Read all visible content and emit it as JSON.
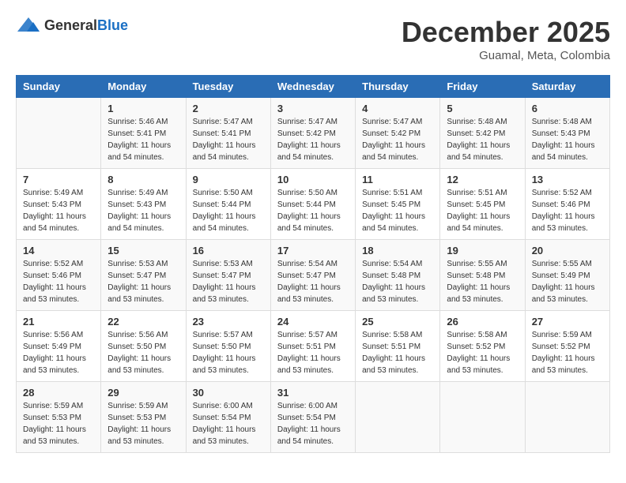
{
  "header": {
    "logo_general": "General",
    "logo_blue": "Blue",
    "month": "December 2025",
    "location": "Guamal, Meta, Colombia"
  },
  "days_of_week": [
    "Sunday",
    "Monday",
    "Tuesday",
    "Wednesday",
    "Thursday",
    "Friday",
    "Saturday"
  ],
  "weeks": [
    [
      {
        "day": "",
        "info": ""
      },
      {
        "day": "1",
        "info": "Sunrise: 5:46 AM\nSunset: 5:41 PM\nDaylight: 11 hours\nand 54 minutes."
      },
      {
        "day": "2",
        "info": "Sunrise: 5:47 AM\nSunset: 5:41 PM\nDaylight: 11 hours\nand 54 minutes."
      },
      {
        "day": "3",
        "info": "Sunrise: 5:47 AM\nSunset: 5:42 PM\nDaylight: 11 hours\nand 54 minutes."
      },
      {
        "day": "4",
        "info": "Sunrise: 5:47 AM\nSunset: 5:42 PM\nDaylight: 11 hours\nand 54 minutes."
      },
      {
        "day": "5",
        "info": "Sunrise: 5:48 AM\nSunset: 5:42 PM\nDaylight: 11 hours\nand 54 minutes."
      },
      {
        "day": "6",
        "info": "Sunrise: 5:48 AM\nSunset: 5:43 PM\nDaylight: 11 hours\nand 54 minutes."
      }
    ],
    [
      {
        "day": "7",
        "info": "Sunrise: 5:49 AM\nSunset: 5:43 PM\nDaylight: 11 hours\nand 54 minutes."
      },
      {
        "day": "8",
        "info": "Sunrise: 5:49 AM\nSunset: 5:43 PM\nDaylight: 11 hours\nand 54 minutes."
      },
      {
        "day": "9",
        "info": "Sunrise: 5:50 AM\nSunset: 5:44 PM\nDaylight: 11 hours\nand 54 minutes."
      },
      {
        "day": "10",
        "info": "Sunrise: 5:50 AM\nSunset: 5:44 PM\nDaylight: 11 hours\nand 54 minutes."
      },
      {
        "day": "11",
        "info": "Sunrise: 5:51 AM\nSunset: 5:45 PM\nDaylight: 11 hours\nand 54 minutes."
      },
      {
        "day": "12",
        "info": "Sunrise: 5:51 AM\nSunset: 5:45 PM\nDaylight: 11 hours\nand 54 minutes."
      },
      {
        "day": "13",
        "info": "Sunrise: 5:52 AM\nSunset: 5:46 PM\nDaylight: 11 hours\nand 53 minutes."
      }
    ],
    [
      {
        "day": "14",
        "info": "Sunrise: 5:52 AM\nSunset: 5:46 PM\nDaylight: 11 hours\nand 53 minutes."
      },
      {
        "day": "15",
        "info": "Sunrise: 5:53 AM\nSunset: 5:47 PM\nDaylight: 11 hours\nand 53 minutes."
      },
      {
        "day": "16",
        "info": "Sunrise: 5:53 AM\nSunset: 5:47 PM\nDaylight: 11 hours\nand 53 minutes."
      },
      {
        "day": "17",
        "info": "Sunrise: 5:54 AM\nSunset: 5:47 PM\nDaylight: 11 hours\nand 53 minutes."
      },
      {
        "day": "18",
        "info": "Sunrise: 5:54 AM\nSunset: 5:48 PM\nDaylight: 11 hours\nand 53 minutes."
      },
      {
        "day": "19",
        "info": "Sunrise: 5:55 AM\nSunset: 5:48 PM\nDaylight: 11 hours\nand 53 minutes."
      },
      {
        "day": "20",
        "info": "Sunrise: 5:55 AM\nSunset: 5:49 PM\nDaylight: 11 hours\nand 53 minutes."
      }
    ],
    [
      {
        "day": "21",
        "info": "Sunrise: 5:56 AM\nSunset: 5:49 PM\nDaylight: 11 hours\nand 53 minutes."
      },
      {
        "day": "22",
        "info": "Sunrise: 5:56 AM\nSunset: 5:50 PM\nDaylight: 11 hours\nand 53 minutes."
      },
      {
        "day": "23",
        "info": "Sunrise: 5:57 AM\nSunset: 5:50 PM\nDaylight: 11 hours\nand 53 minutes."
      },
      {
        "day": "24",
        "info": "Sunrise: 5:57 AM\nSunset: 5:51 PM\nDaylight: 11 hours\nand 53 minutes."
      },
      {
        "day": "25",
        "info": "Sunrise: 5:58 AM\nSunset: 5:51 PM\nDaylight: 11 hours\nand 53 minutes."
      },
      {
        "day": "26",
        "info": "Sunrise: 5:58 AM\nSunset: 5:52 PM\nDaylight: 11 hours\nand 53 minutes."
      },
      {
        "day": "27",
        "info": "Sunrise: 5:59 AM\nSunset: 5:52 PM\nDaylight: 11 hours\nand 53 minutes."
      }
    ],
    [
      {
        "day": "28",
        "info": "Sunrise: 5:59 AM\nSunset: 5:53 PM\nDaylight: 11 hours\nand 53 minutes."
      },
      {
        "day": "29",
        "info": "Sunrise: 5:59 AM\nSunset: 5:53 PM\nDaylight: 11 hours\nand 53 minutes."
      },
      {
        "day": "30",
        "info": "Sunrise: 6:00 AM\nSunset: 5:54 PM\nDaylight: 11 hours\nand 53 minutes."
      },
      {
        "day": "31",
        "info": "Sunrise: 6:00 AM\nSunset: 5:54 PM\nDaylight: 11 hours\nand 54 minutes."
      },
      {
        "day": "",
        "info": ""
      },
      {
        "day": "",
        "info": ""
      },
      {
        "day": "",
        "info": ""
      }
    ]
  ]
}
